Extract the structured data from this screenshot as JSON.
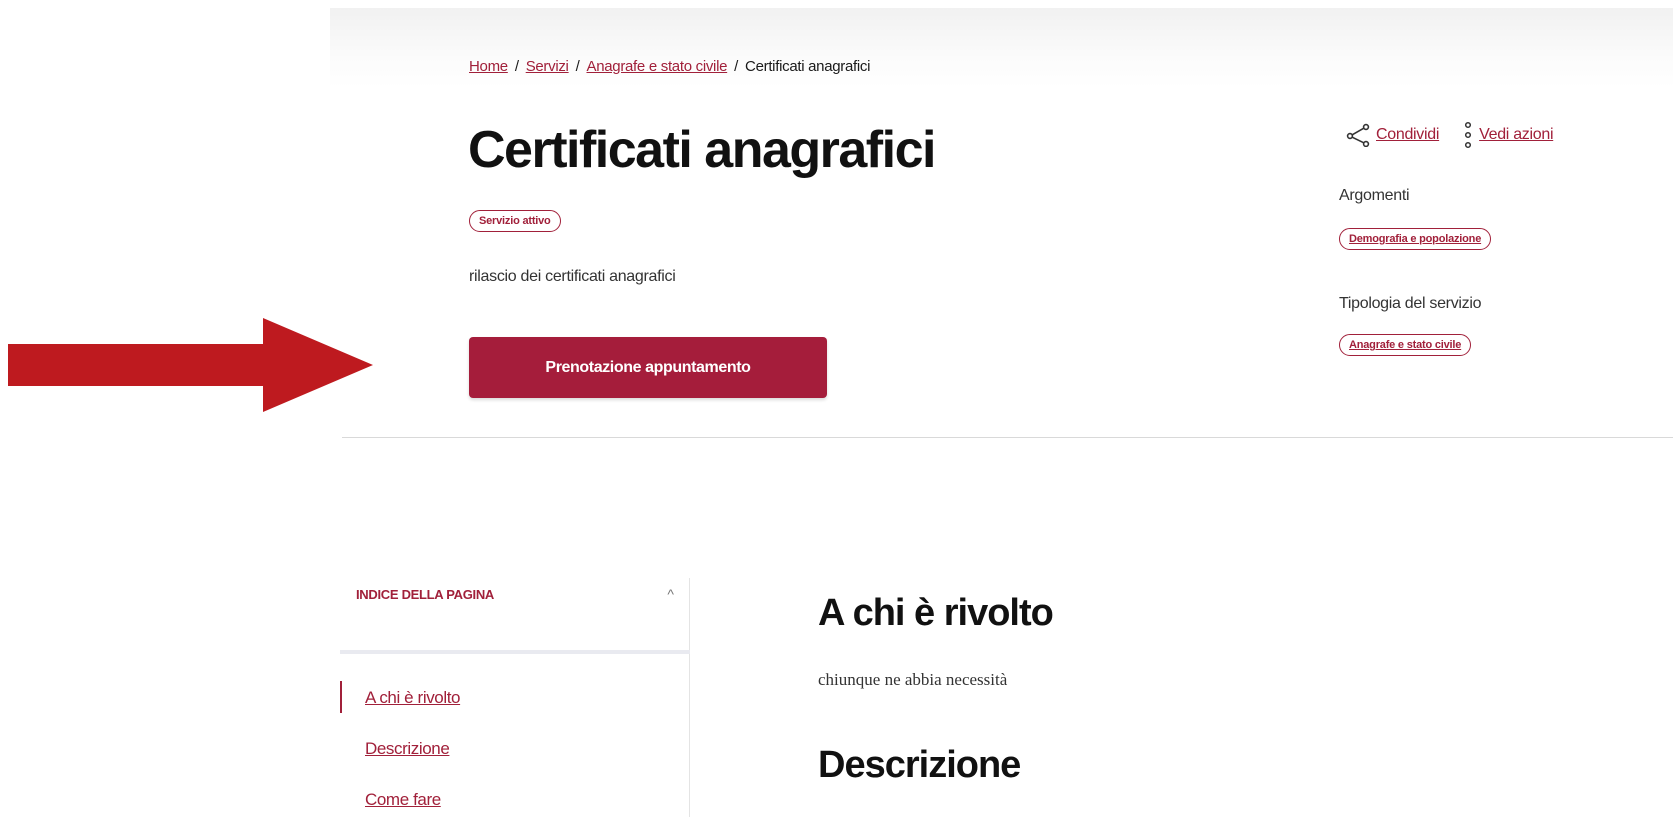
{
  "breadcrumb": {
    "items": [
      {
        "label": "Home"
      },
      {
        "label": "Servizi"
      },
      {
        "label": "Anagrafe e stato civile"
      },
      {
        "label": "Certificati anagrafici"
      }
    ],
    "separator": "/"
  },
  "page": {
    "title": "Certificati anagrafici",
    "status_badge": "Servizio attivo",
    "summary": "rilascio dei certificati anagrafici",
    "cta_label": "Prenotazione appuntamento"
  },
  "actions": {
    "share_label": "Condividi",
    "share_icon": "share-icon",
    "more_label": "Vedi azioni",
    "more_icon": "vertical-dots-icon"
  },
  "meta": {
    "topics_label": "Argomenti",
    "topics": [
      "Demografia e popolazione"
    ],
    "service_type_label": "Tipologia del servizio",
    "service_types": [
      "Anagrafe e stato civile"
    ]
  },
  "toc": {
    "title": "INDICE DELLA PAGINA",
    "items": [
      {
        "label": "A chi è rivolto",
        "active": true
      },
      {
        "label": "Descrizione",
        "active": false
      },
      {
        "label": "Come fare",
        "active": false
      }
    ]
  },
  "sections": [
    {
      "title": "A chi è rivolto",
      "text": "chiunque ne abbia necessità"
    },
    {
      "title": "Descrizione"
    }
  ],
  "colors": {
    "brand": "#a1203a",
    "button": "#a51d3b",
    "annotation_arrow": "#be1a1f"
  }
}
